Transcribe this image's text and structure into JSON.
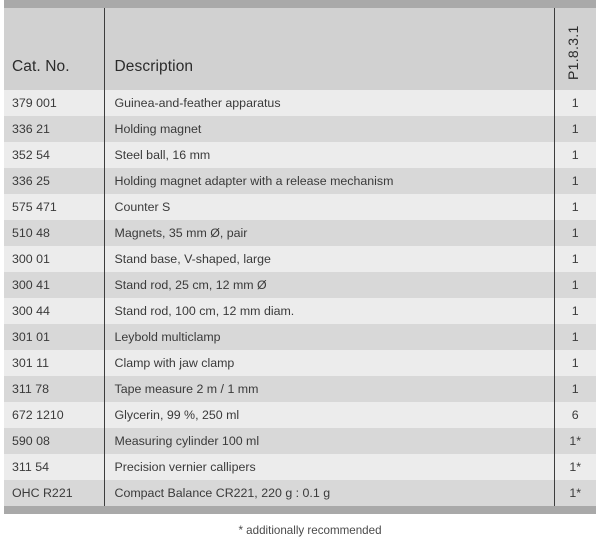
{
  "table": {
    "columns": {
      "cat_no_header": "Cat. No.",
      "description_header": "Description",
      "quantity_header": "P1.8.3.1"
    },
    "rows": [
      {
        "cat_no": "379 001",
        "description": "Guinea-and-feather apparatus",
        "quantity": "1"
      },
      {
        "cat_no": "336 21",
        "description": "Holding magnet",
        "quantity": "1"
      },
      {
        "cat_no": "352 54",
        "description": "Steel ball, 16 mm",
        "quantity": "1"
      },
      {
        "cat_no": "336 25",
        "description": "Holding magnet adapter with a release mechanism",
        "quantity": "1"
      },
      {
        "cat_no": "575 471",
        "description": "Counter S",
        "quantity": "1"
      },
      {
        "cat_no": "510 48",
        "description": "Magnets, 35 mm Ø, pair",
        "quantity": "1"
      },
      {
        "cat_no": "300 01",
        "description": "Stand base, V-shaped, large",
        "quantity": "1"
      },
      {
        "cat_no": "300 41",
        "description": "Stand rod, 25 cm, 12 mm Ø",
        "quantity": "1"
      },
      {
        "cat_no": "300 44",
        "description": "Stand rod, 100 cm, 12 mm diam.",
        "quantity": "1"
      },
      {
        "cat_no": "301 01",
        "description": "Leybold multiclamp",
        "quantity": "1"
      },
      {
        "cat_no": "301 11",
        "description": "Clamp with jaw clamp",
        "quantity": "1"
      },
      {
        "cat_no": "311 78",
        "description": "Tape measure 2 m / 1 mm",
        "quantity": "1"
      },
      {
        "cat_no": "672 1210",
        "description": "Glycerin, 99 %, 250 ml",
        "quantity": "6"
      },
      {
        "cat_no": "590 08",
        "description": "Measuring cylinder 100 ml",
        "quantity": "1*"
      },
      {
        "cat_no": "311 54",
        "description": "Precision vernier callipers",
        "quantity": "1*"
      },
      {
        "cat_no": "OHC R221",
        "description": "Compact Balance CR221, 220 g : 0.1 g",
        "quantity": "1*"
      }
    ]
  },
  "footnote": "* additionally recommended",
  "colors": {
    "bar": "#a9a9a9",
    "header_bg": "#d1d1d1",
    "row_light": "#ececec",
    "row_dark": "#d8d8d8",
    "divider": "#3d3d3d",
    "text": "#3a3a3a"
  }
}
